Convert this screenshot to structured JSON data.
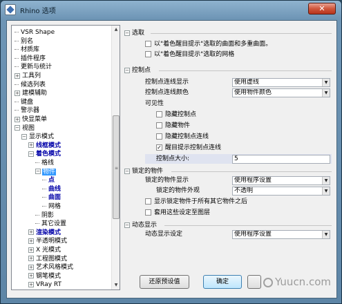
{
  "window": {
    "title": "Rhino 选项",
    "close_glyph": "✕"
  },
  "tree": {
    "items": [
      {
        "label": "VSR Shape",
        "indent": 1,
        "expander": "",
        "style": ""
      },
      {
        "label": "别名",
        "indent": 1,
        "expander": "",
        "style": ""
      },
      {
        "label": "材质库",
        "indent": 1,
        "expander": "",
        "style": ""
      },
      {
        "label": "插件程序",
        "indent": 1,
        "expander": "",
        "style": ""
      },
      {
        "label": "更新与统计",
        "indent": 1,
        "expander": "",
        "style": ""
      },
      {
        "label": "工具列",
        "indent": 1,
        "expander": "+",
        "style": ""
      },
      {
        "label": "候选列表",
        "indent": 1,
        "expander": "",
        "style": ""
      },
      {
        "label": "建模辅助",
        "indent": 1,
        "expander": "+",
        "style": ""
      },
      {
        "label": "键盘",
        "indent": 1,
        "expander": "",
        "style": ""
      },
      {
        "label": "警示器",
        "indent": 1,
        "expander": "",
        "style": ""
      },
      {
        "label": "快显菜单",
        "indent": 1,
        "expander": "+",
        "style": ""
      },
      {
        "label": "视图",
        "indent": 1,
        "expander": "−",
        "style": ""
      },
      {
        "label": "显示模式",
        "indent": 2,
        "expander": "−",
        "style": ""
      },
      {
        "label": "线框模式",
        "indent": 3,
        "expander": "+",
        "style": "bold"
      },
      {
        "label": "着色模式",
        "indent": 3,
        "expander": "−",
        "style": "bold"
      },
      {
        "label": "格线",
        "indent": 4,
        "expander": "",
        "style": ""
      },
      {
        "label": "物件",
        "indent": 4,
        "expander": "−",
        "style": "sel"
      },
      {
        "label": "点",
        "indent": 5,
        "expander": "",
        "style": "bold"
      },
      {
        "label": "曲线",
        "indent": 5,
        "expander": "",
        "style": "bold"
      },
      {
        "label": "曲面",
        "indent": 5,
        "expander": "",
        "style": "bold"
      },
      {
        "label": "网格",
        "indent": 5,
        "expander": "",
        "style": ""
      },
      {
        "label": "阴影",
        "indent": 4,
        "expander": "",
        "style": ""
      },
      {
        "label": "其它设置",
        "indent": 4,
        "expander": "",
        "style": ""
      },
      {
        "label": "渲染模式",
        "indent": 3,
        "expander": "+",
        "style": "bold"
      },
      {
        "label": "半透明模式",
        "indent": 3,
        "expander": "+",
        "style": ""
      },
      {
        "label": "X 光模式",
        "indent": 3,
        "expander": "+",
        "style": ""
      },
      {
        "label": "工程图模式",
        "indent": 3,
        "expander": "+",
        "style": ""
      },
      {
        "label": "艺术风格模式",
        "indent": 3,
        "expander": "+",
        "style": ""
      },
      {
        "label": "钢笔模式",
        "indent": 3,
        "expander": "+",
        "style": ""
      },
      {
        "label": "VRay RT",
        "indent": 3,
        "expander": "+",
        "style": ""
      }
    ]
  },
  "sections": {
    "select": {
      "title": "选取",
      "opt1": "以\"着色醒目提示\"选取的曲面和多重曲面。",
      "opt2": "以\"着色醒目提示\"选取的网格"
    },
    "control_points": {
      "title": "控制点",
      "display_label": "控制点连线显示",
      "display_value": "使用虚线",
      "color_label": "控制点连线颜色",
      "color_value": "使用物件颜色",
      "visibility_label": "可见性",
      "hide_points": "隐藏控制点",
      "hide_objects": "隐藏物件",
      "hide_lines": "隐藏控制点连线",
      "highlight_lines": "醒目提示控制点连线",
      "size_label": "控制点大小:",
      "size_value": "5"
    },
    "locked": {
      "title": "锁定的物件",
      "display_label": "锁定的物件显示",
      "display_value": "使用程序设置",
      "appearance_label": "锁定的物件外观",
      "appearance_value": "不透明",
      "opt_behind": "显示锁定物件于所有其它物件之后",
      "opt_layer": "套用这些设定至图层"
    },
    "dynamic": {
      "title": "动态显示",
      "setting_label": "动态显示设定",
      "setting_value": "使用程序设置"
    }
  },
  "buttons": {
    "restore": "还原预设值",
    "ok": "确定"
  },
  "watermark": "Yuucn.com"
}
